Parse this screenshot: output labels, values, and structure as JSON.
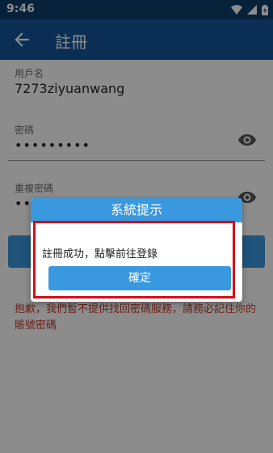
{
  "status_bar": {
    "time": "9:46"
  },
  "app_bar": {
    "title": "註冊",
    "back_icon": "arrow-back-icon"
  },
  "form": {
    "username": {
      "label": "用戶名",
      "value": "7273ziyuanwang"
    },
    "password": {
      "label": "密碼",
      "masked_value": "•••••••••"
    },
    "confirm_password": {
      "label": "重複密碼",
      "masked_value": "•••"
    }
  },
  "notice": "抱歉，我們暫不提供找回密碼服務，請務必記住你的賬號密碼",
  "dialog": {
    "title": "系統提示",
    "message": "註冊成功，點擊前往登錄",
    "confirm_label": "確定"
  },
  "colors": {
    "status_bar": "#0b3d6b",
    "app_bar": "#14579a",
    "accent": "#3a98df",
    "warning_text": "#c0392b",
    "highlight": "#d0101a"
  }
}
